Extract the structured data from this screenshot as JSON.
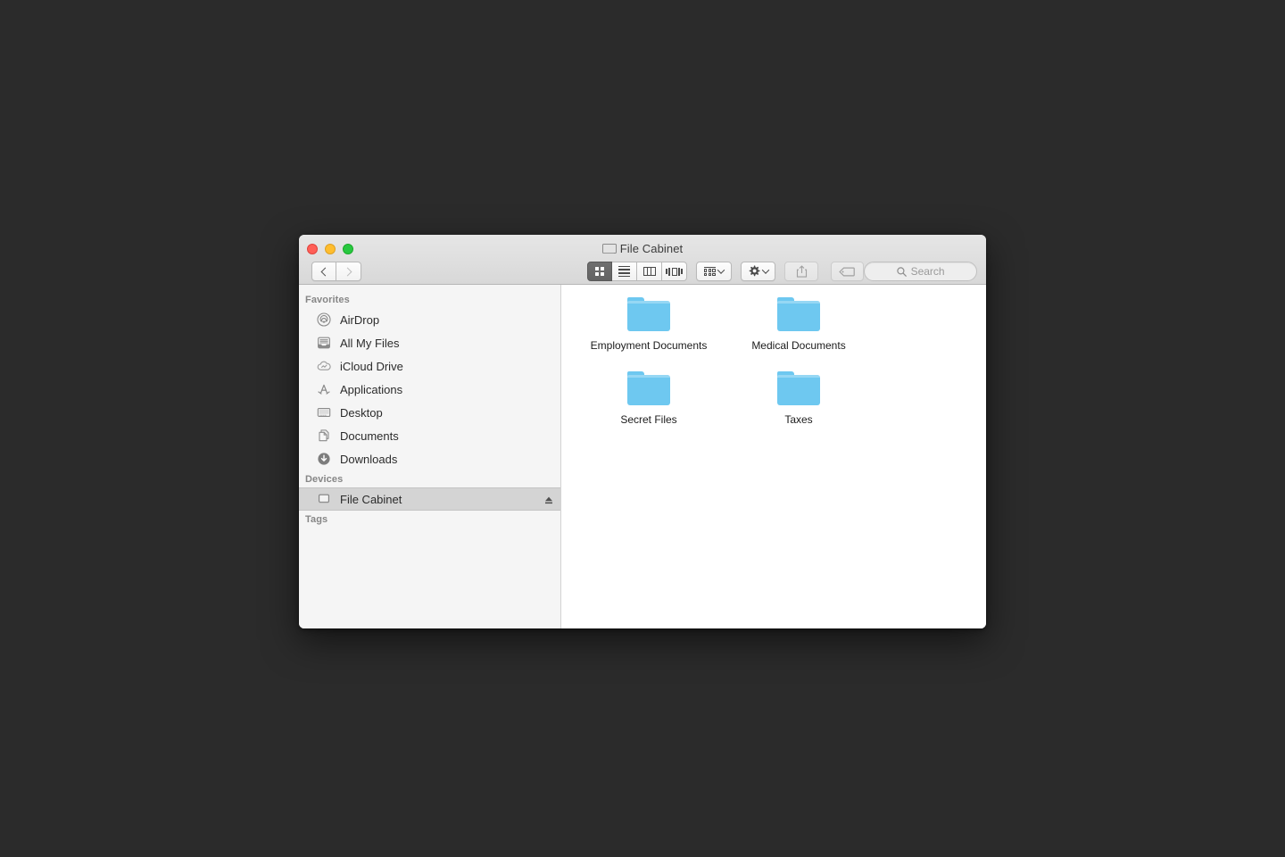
{
  "window": {
    "title": "File Cabinet",
    "title_icon": "hard-drive-icon",
    "traffic_lights": {
      "close_label": "Close",
      "minimize_label": "Minimize",
      "maximize_label": "Maximize"
    },
    "colors": {
      "desktop_background": "#2b2b2b",
      "titlebar_top": "#e6e6e6",
      "titlebar_bottom": "#d8d8d8",
      "sidebar_background": "#f5f5f5",
      "sidebar_selected": "#d4d4d4",
      "content_background": "#ffffff",
      "folder_blue": "#6ec8f0",
      "close_button": "#ff5f57",
      "minimize_button": "#ffbd2e",
      "maximize_button": "#28c840",
      "view_active_button": "#6f6f6f"
    }
  },
  "toolbar": {
    "back_label": "Back",
    "forward_label": "Forward",
    "view_modes": [
      {
        "name": "icon-view",
        "label": "Icon View",
        "active": true
      },
      {
        "name": "list-view",
        "label": "List View",
        "active": false
      },
      {
        "name": "column-view",
        "label": "Column View",
        "active": false
      },
      {
        "name": "coverflow-view",
        "label": "Cover Flow View",
        "active": false
      }
    ],
    "arrange_label": "Arrange By",
    "action_label": "Action",
    "share_label": "Share",
    "tag_label": "Edit Tags",
    "search": {
      "placeholder": "Search",
      "value": ""
    }
  },
  "sidebar": {
    "sections": [
      {
        "header": "Favorites",
        "items": [
          {
            "label": "AirDrop",
            "icon": "airdrop-icon",
            "selected": false
          },
          {
            "label": "All My Files",
            "icon": "all-my-files-icon",
            "selected": false
          },
          {
            "label": "iCloud Drive",
            "icon": "icloud-drive-icon",
            "selected": false
          },
          {
            "label": "Applications",
            "icon": "applications-icon",
            "selected": false
          },
          {
            "label": "Desktop",
            "icon": "desktop-icon",
            "selected": false
          },
          {
            "label": "Documents",
            "icon": "documents-icon",
            "selected": false
          },
          {
            "label": "Downloads",
            "icon": "downloads-icon",
            "selected": false
          }
        ]
      },
      {
        "header": "Devices",
        "items": [
          {
            "label": "File Cabinet",
            "icon": "hard-drive-icon",
            "selected": true,
            "eject": true
          }
        ]
      },
      {
        "header": "Tags",
        "items": []
      }
    ]
  },
  "content": {
    "items": [
      {
        "name": "Employment Documents",
        "type": "folder"
      },
      {
        "name": "Medical Documents",
        "type": "folder"
      },
      {
        "name": "Secret Files",
        "type": "folder"
      },
      {
        "name": "Taxes",
        "type": "folder"
      }
    ]
  }
}
